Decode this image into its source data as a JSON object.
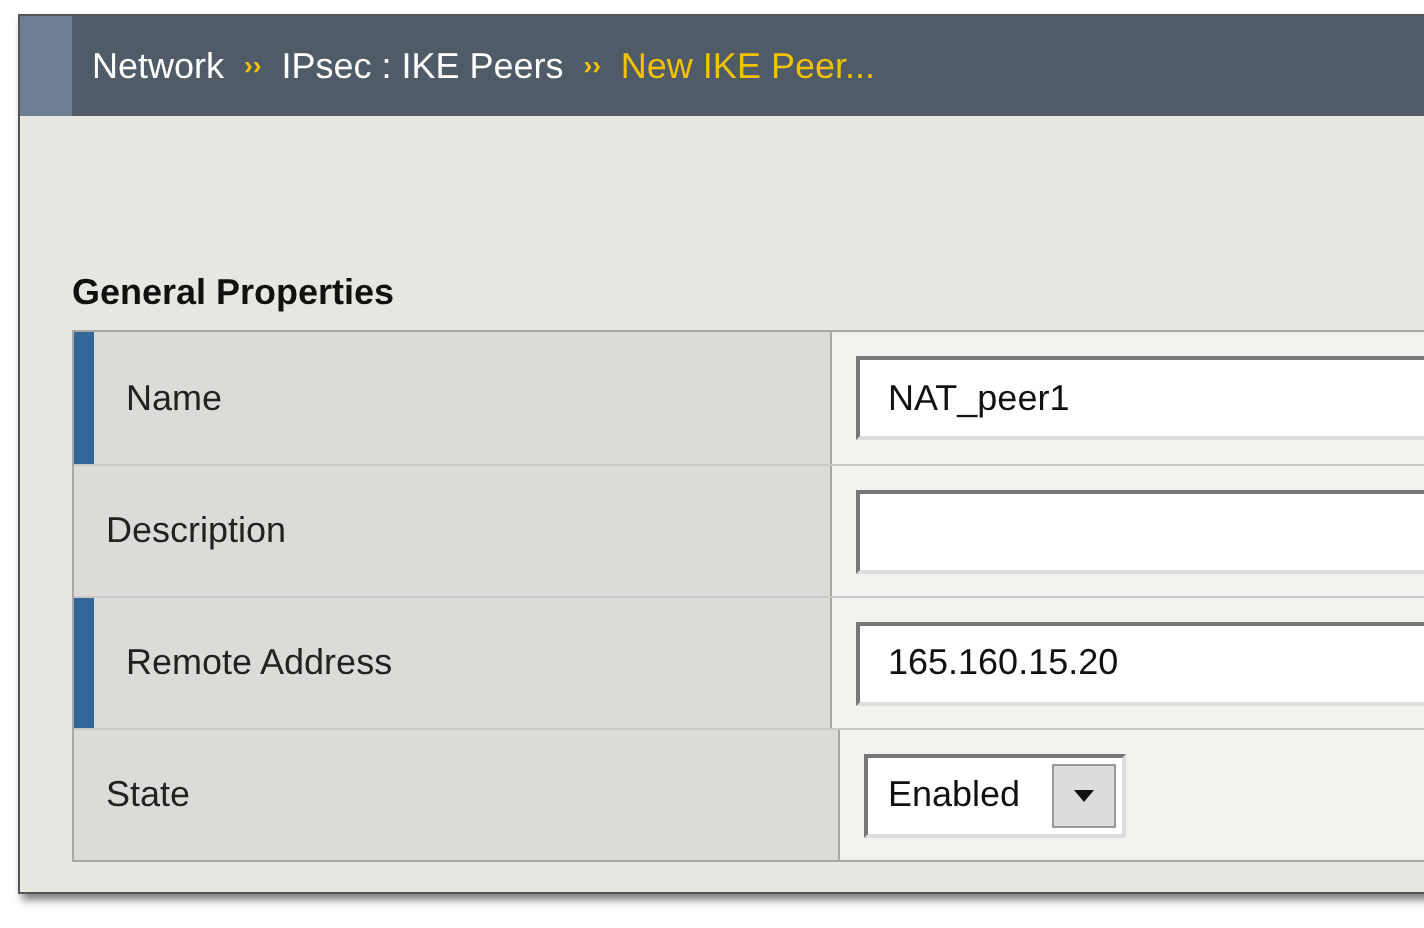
{
  "breadcrumb": [
    {
      "label": "Network",
      "current": false
    },
    {
      "label": "IPsec : IKE Peers",
      "current": false
    },
    {
      "label": "New IKE Peer...",
      "current": true
    }
  ],
  "separator": "››",
  "section_title": "General Properties",
  "fields": [
    {
      "label": "Name",
      "kind": "text",
      "required": true,
      "value": "NAT_peer1"
    },
    {
      "label": "Description",
      "kind": "text",
      "required": false
    },
    {
      "label": "Remote Address",
      "kind": "text",
      "required": true,
      "value": "165.160.15.20"
    },
    {
      "label": "State",
      "kind": "select",
      "required": false,
      "value": "Enabled"
    }
  ]
}
